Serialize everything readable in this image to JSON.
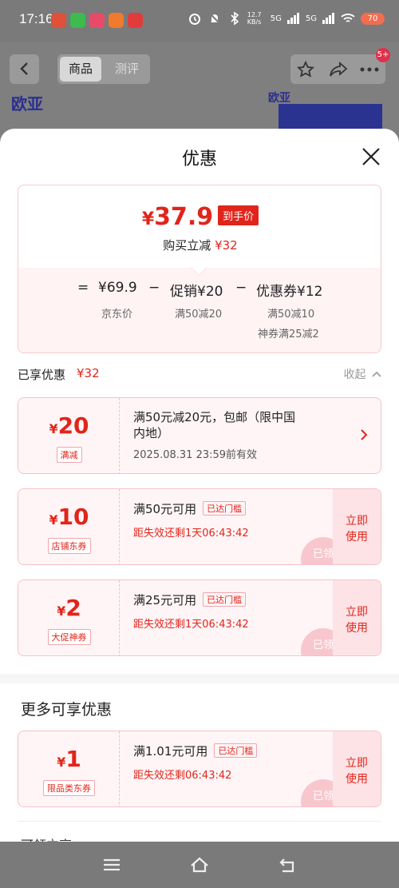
{
  "status_bar": {
    "time": "17:16",
    "speed": "12.7 KB/s",
    "net1": "5G",
    "net2": "5G",
    "battery": "70"
  },
  "background_page": {
    "tabs": [
      "商品",
      "测评"
    ],
    "badge": "5+",
    "logo_text": "欧亚",
    "logo_small": "欧亚"
  },
  "sheet": {
    "title": "优惠",
    "summary": {
      "currency": "¥",
      "final_price": "37.9",
      "price_tag": "到手价",
      "reduce_label": "购买立减",
      "reduce_amount": "¥32",
      "formula": {
        "eq": "=",
        "base_price": "¥69.9",
        "minus1": "−",
        "promo": "促销¥20",
        "minus2": "−",
        "coupon": "优惠券¥12"
      },
      "sub_labels": {
        "base": "京东价",
        "promo": "满50减20",
        "coupon1": "满50减10",
        "coupon2": "神券满25减2"
      }
    },
    "enjoyed": {
      "label": "已享优惠",
      "amount": "¥32",
      "collapse": "收起"
    },
    "coupons": [
      {
        "currency": "¥",
        "value": "20",
        "tag": "满减",
        "desc_line1": "满50元减20元，包邮（限中国",
        "desc_line2": "内地）",
        "sub": "2025.08.31 23:59前有效"
      },
      {
        "currency": "¥",
        "value": "10",
        "tag": "店铺东券",
        "desc": "满50元可用",
        "reached": "已达门槛",
        "sub": "距失效还剩1天06:43:42",
        "use": "立即使用",
        "stamp": "已领"
      },
      {
        "currency": "¥",
        "value": "2",
        "tag": "大促神券",
        "desc": "满25元可用",
        "reached": "已达门槛",
        "sub": "距失效还剩1天06:43:42",
        "use": "立即使用",
        "stamp": "已领"
      }
    ],
    "more": {
      "title": "更多可享优惠",
      "coupons": [
        {
          "currency": "¥",
          "value": "1",
          "tag": "限品类东券",
          "desc": "满1.01元可用",
          "reached": "已达门槛",
          "sub": "距失效还剩06:43:42",
          "use": "立即使用",
          "stamp": "已领"
        }
      ],
      "cut_text": "可领立享"
    }
  },
  "colors": {
    "accent": "#e1251b",
    "coupon_bg": "#fff5f6",
    "overlay": "#7d7d7d"
  }
}
